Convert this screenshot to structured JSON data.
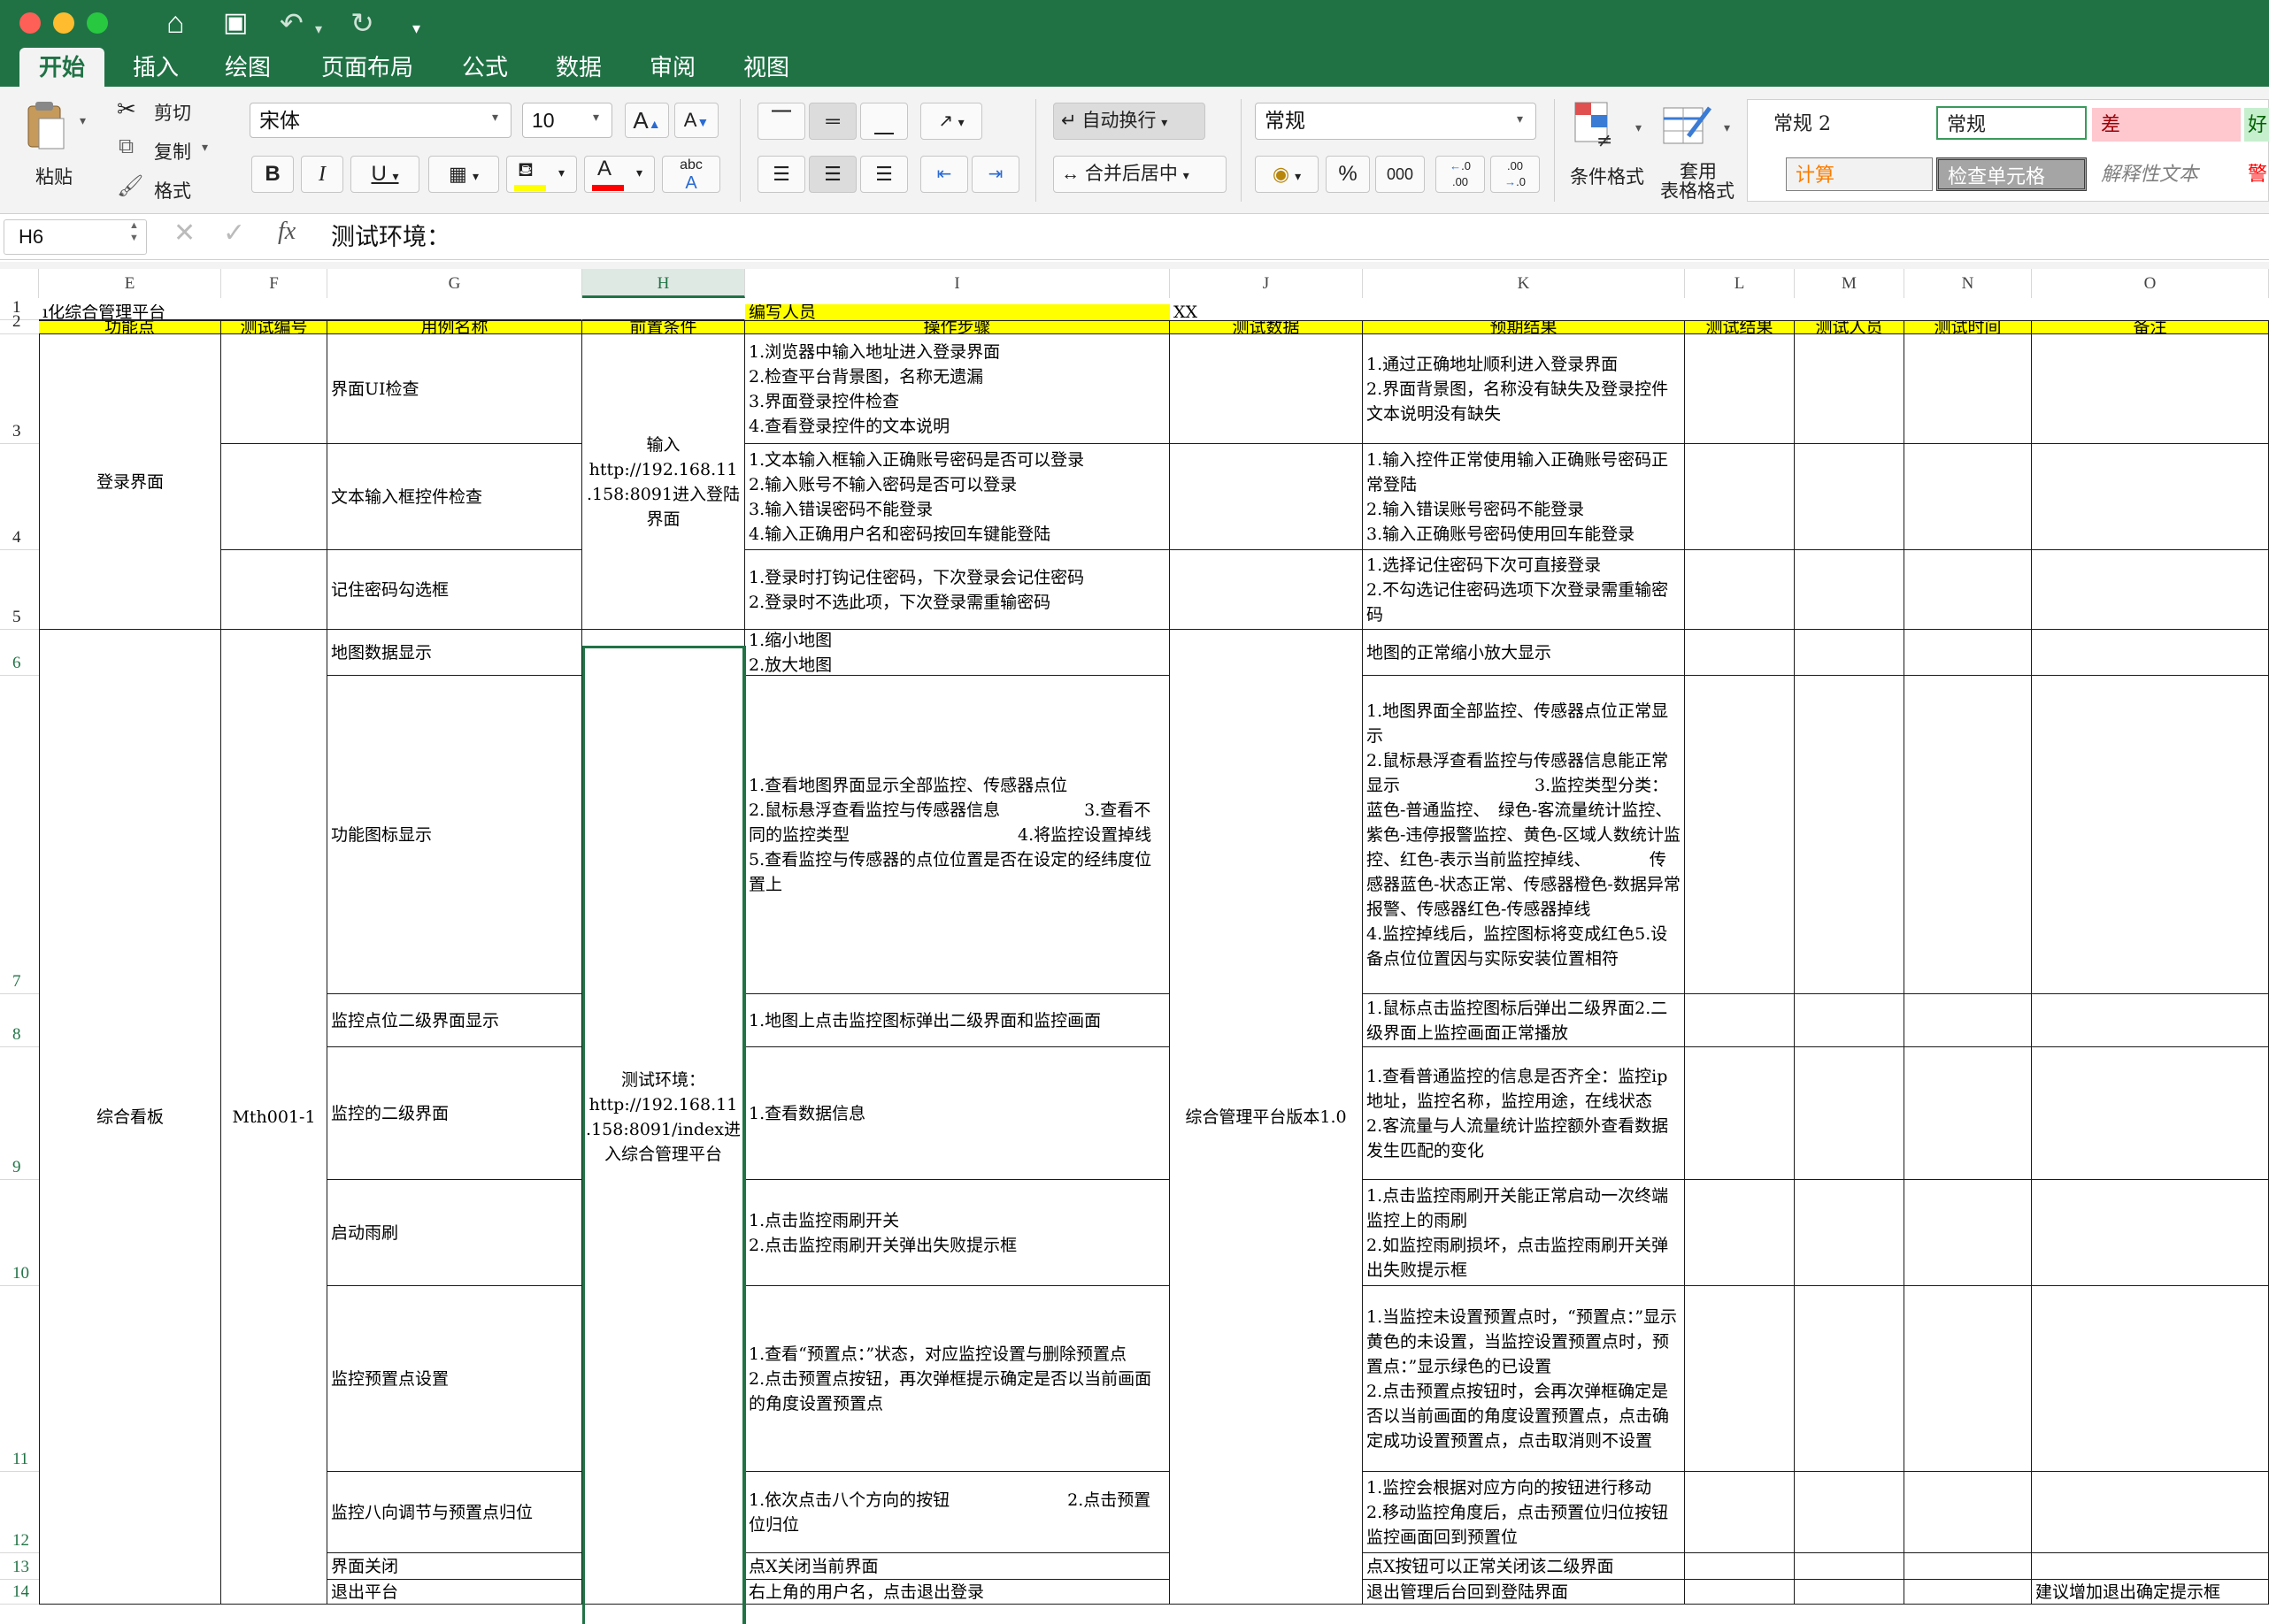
{
  "titlebar": {
    "home_icon": "home-icon",
    "save_icon": "save-icon",
    "undo_icon": "undo-icon",
    "redo_icon": "redo-icon",
    "more_icon": "customize-icon"
  },
  "tabs": [
    "开始",
    "插入",
    "绘图",
    "页面布局",
    "公式",
    "数据",
    "审阅",
    "视图"
  ],
  "ribbon": {
    "paste": "粘贴",
    "cut": "剪切",
    "copy": "复制",
    "format_painter": "格式",
    "font_name": "宋体",
    "font_size": "10",
    "wrap_text": "自动换行",
    "merge_center": "合并后居中",
    "number_format": "常规",
    "cond_format": "条件格式",
    "table_format_1": "套用",
    "table_format_2": "表格格式",
    "styles": {
      "normal2": "常规 2",
      "normal": "常规",
      "bad": "差",
      "good": "好",
      "calc": "计算",
      "check": "检查单元格",
      "explanatory": "解释性文本",
      "warning": "警"
    },
    "colors": {
      "fill": "#ffff00",
      "font": "#ff0000",
      "bad_bg": "#ffc7ce",
      "bad_fg": "#9c0006",
      "good_fg": "#006100",
      "calc_fg": "#fa7d00",
      "check_bg": "#a5a5a5",
      "warn_fg": "#ff0000"
    }
  },
  "formula_bar": {
    "name_box": "H6",
    "value": "测试环境："
  },
  "columns": [
    "E",
    "F",
    "G",
    "H",
    "I",
    "J",
    "K",
    "L",
    "M",
    "N",
    "O"
  ],
  "rows": [
    "1",
    "2",
    "3",
    "4",
    "5",
    "6",
    "7",
    "8",
    "9",
    "10",
    "11",
    "12",
    "13",
    "14"
  ],
  "sheet": {
    "row1": {
      "e": "ı化综合管理平台",
      "i": "编写人员",
      "j": "XX"
    },
    "headers": [
      "功能点",
      "测试编号",
      "用例名称",
      "前置条件",
      "操作步骤",
      "测试数据",
      "预期结果",
      "测试结果",
      "测试人员",
      "测试时间",
      "备注"
    ],
    "login": {
      "feature": "登录界面",
      "precondition": "输入\nhttp://192.168.11\n.158:8091进入登陆\n界面",
      "cases": [
        {
          "name": "界面UI检查",
          "steps": "1.浏览器中输入地址进入登录界面\n2.检查平台背景图，名称无遗漏\n3.界面登录控件检查\n4.查看登录控件的文本说明",
          "expected": "1.通过正确地址顺利进入登录界面\n2.界面背景图，名称没有缺失及登录控件文本说明没有缺失"
        },
        {
          "name": "文本输入框控件检查",
          "steps": "1.文本输入框输入正确账号密码是否可以登录\n2.输入账号不输入密码是否可以登录\n3.输入错误密码不能登录\n4.输入正确用户名和密码按回车键能登陆",
          "expected": "1.输入控件正常使用输入正确账号密码正常登陆\n2.输入错误账号密码不能登录\n3.输入正确账号密码使用回车能登录"
        },
        {
          "name": "记住密码勾选框",
          "steps": "1.登录时打钩记住密码，下次登录会记住密码\n2.登录时不选此项，下次登录需重输密码",
          "expected": "1.选择记住密码下次可直接登录\n2.不勾选记住密码选项下次登录需重输密码"
        }
      ]
    },
    "dashboard": {
      "feature": "综合看板",
      "test_id": "Mth001-1",
      "precondition": "测试环境：\nhttp://192.168.11\n.158:8091/index进\n入综合管理平台",
      "test_data": "综合管理平台版本1.0",
      "cases": [
        {
          "name": "地图数据显示",
          "steps": "1.缩小地图\n2.放大地图",
          "expected": "地图的正常缩小放大显示"
        },
        {
          "name": "功能图标显示",
          "steps": "1.查看地图界面显示全部监控、传感器点位\n2.鼠标悬浮查看监控与传感器信息　　　　　3.查看不同的监控类型　　　　　　　　　　4.将监控设置掉线　　　　　　　　　　　　5.查看监控与传感器的点位位置是否在设定的经纬度位置上",
          "expected": "1.地图界面全部监控、传感器点位正常显示\n2.鼠标悬浮查看监控与传感器信息能正常显示　　　　　　　　3.监控类型分类：蓝色-普通监控、　绿色-客流量统计监控、　　　紫色-违停报警监控、黄色-区域人数统计监控、红色-表示当前监控掉线、　　　　传感器蓝色-状态正常、传感器橙色-数据异常报警、传感器红色-传感器掉线\n4.监控掉线后，监控图标将变成红色5.设备点位位置因与实际安装位置相符"
        },
        {
          "name": "监控点位二级界面显示",
          "steps": "1.地图上点击监控图标弹出二级界面和监控画面",
          "expected": "1.鼠标点击监控图标后弹出二级界面2.二级界面上监控画面正常播放"
        },
        {
          "name": "监控的二级界面",
          "steps": "1.查看数据信息",
          "expected": "1.查看普通监控的信息是否齐全：监控ip地址，监控名称，监控用途，在线状态\n2.客流量与人流量统计监控额外查看数据发生匹配的变化"
        },
        {
          "name": "启动雨刷",
          "steps": "1.点击监控雨刷开关\n2.点击监控雨刷开关弹出失败提示框",
          "expected": "1.点击监控雨刷开关能正常启动一次终端监控上的雨刷\n2.如监控雨刷损坏，点击监控雨刷开关弹出失败提示框"
        },
        {
          "name": "监控预置点设置",
          "steps": "1.查看“预置点：”状态，对应监控设置与删除预置点\n2.点击预置点按钮，再次弹框提示确定是否以当前画面的角度设置预置点",
          "expected": "1.当监控未设置预置点时，“预置点：”显示黄色的未设置，当监控设置预置点时，预置点：”显示绿色的已设置\n2.点击预置点按钮时，会再次弹框确定是否以当前画面的角度设置预置点，点击确定成功设置预置点，点击取消则不设置"
        },
        {
          "name": "监控八向调节与预置点归位",
          "steps": "1.依次点击八个方向的按钮　　　　　　　2.点击预置位归位",
          "expected": "1.监控会根据对应方向的按钮进行移动\n2.移动监控角度后，点击预置位归位按钮监控画面回到预置位"
        },
        {
          "name": "界面关闭",
          "steps": "点X关闭当前界面",
          "expected": "点X按钮可以正常关闭该二级界面"
        },
        {
          "name": "退出平台",
          "steps": "右上角的用户名，点击退出登录",
          "expected": "退出管理后台回到登陆界面",
          "note": "建议增加退出确定提示框"
        }
      ]
    }
  }
}
